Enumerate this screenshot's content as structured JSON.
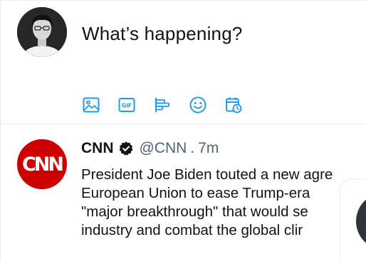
{
  "composer": {
    "placeholder": "What’s happening?",
    "tools": [
      {
        "name": "image-icon"
      },
      {
        "name": "gif-icon",
        "label": "GIF"
      },
      {
        "name": "poll-icon"
      },
      {
        "name": "emoji-icon"
      },
      {
        "name": "schedule-icon"
      }
    ]
  },
  "tweet": {
    "author": "CNN",
    "handle": "@CNN",
    "separator": ".",
    "time": "7m",
    "avatar_text": "CNN",
    "lines": [
      "President Joe Biden touted a new agre",
      "European Union to ease Trump-era",
      "\"major breakthrough\" that would se",
      "industry and combat the global clir"
    ]
  },
  "colors": {
    "accent": "#1d9bf0",
    "cnn_red": "#cc0000",
    "text": "#0f1419",
    "muted": "#536471"
  }
}
